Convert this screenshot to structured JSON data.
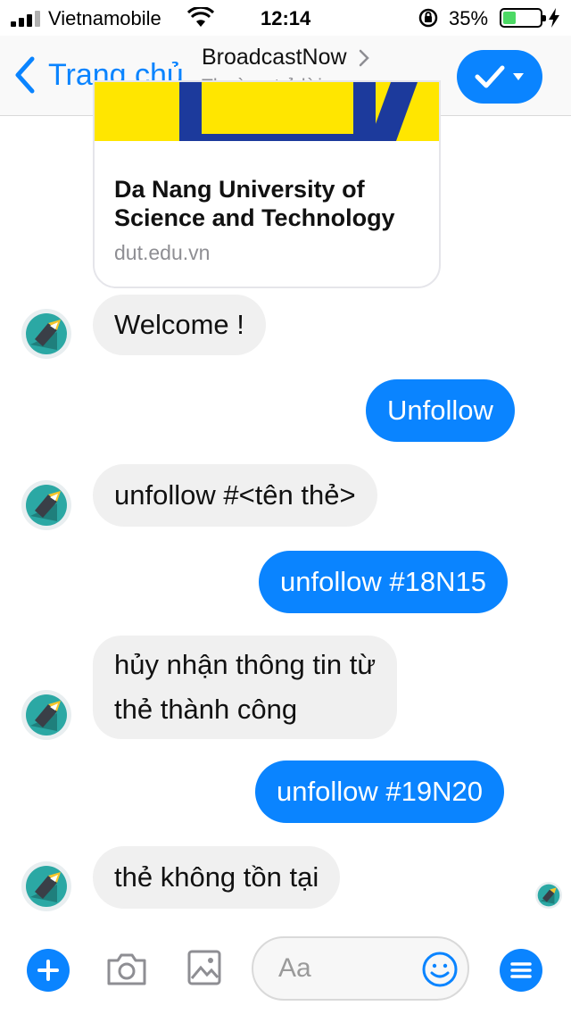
{
  "status_bar": {
    "carrier": "Vietnamobile",
    "time": "12:14",
    "battery_percent": "35%",
    "battery_level": 0.35,
    "icons": [
      "signal-icon",
      "wifi-icon",
      "rotation-lock-icon",
      "battery-icon",
      "charging-icon"
    ]
  },
  "header": {
    "back_label": "Trang chủ",
    "title": "BroadcastNow",
    "subtitle": "Thường trả lời ngay",
    "accent": "#0a84ff"
  },
  "link_card": {
    "title": "Da Nang University of Science and Technology",
    "url": "dut.edu.vn"
  },
  "messages": [
    {
      "from": "bot",
      "text": "Welcome !"
    },
    {
      "from": "me",
      "text": "Unfollow"
    },
    {
      "from": "bot",
      "text": "unfollow #<tên thẻ>"
    },
    {
      "from": "me",
      "text": "unfollow #18N15"
    },
    {
      "from": "bot",
      "lines": [
        "hủy nhận thông tin từ",
        "thẻ thành công"
      ]
    },
    {
      "from": "me",
      "text": "unfollow #19N20"
    },
    {
      "from": "bot",
      "text": "thẻ không tồn tại"
    }
  ],
  "composer": {
    "placeholder": "Aa",
    "icons": [
      "plus-icon",
      "camera-icon",
      "image-icon",
      "emoji-icon",
      "menu-icon"
    ]
  }
}
